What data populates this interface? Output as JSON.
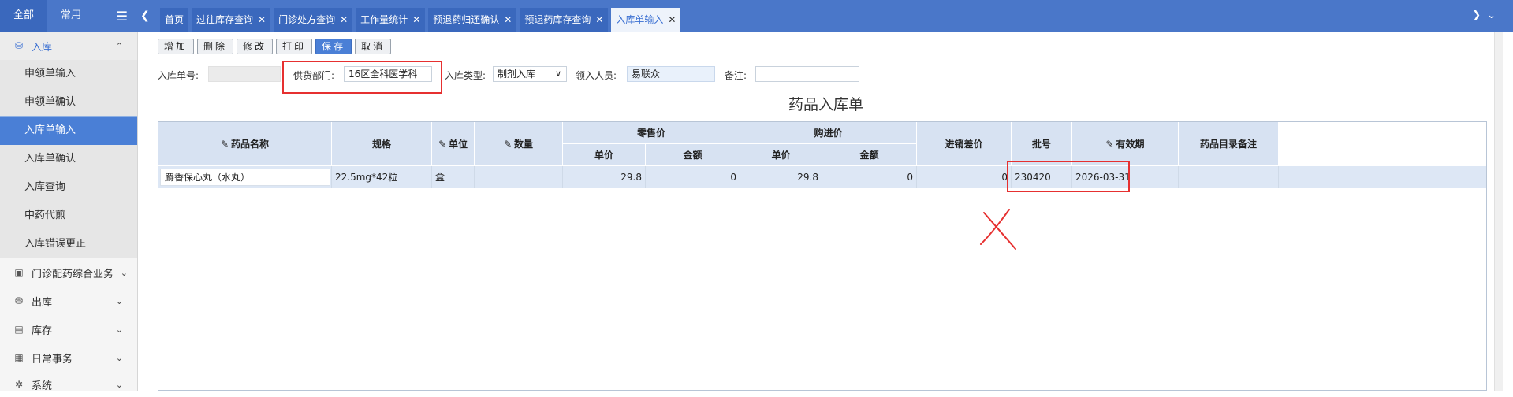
{
  "sidebar": {
    "tabs": [
      "全部",
      "常用"
    ],
    "groups": {
      "inbound": "入库",
      "outpatient": "门诊配药综合业务",
      "outbound": "出库",
      "stock": "库存",
      "daily": "日常事务",
      "system": "系统"
    },
    "inbound_items": [
      "申领单输入",
      "申领单确认",
      "入库单输入",
      "入库单确认",
      "入库查询",
      "中药代煎",
      "入库错误更正"
    ]
  },
  "tabs": [
    "首页",
    "过往库存查询",
    "门诊处方查询",
    "工作量统计",
    "预退药归还确认",
    "预退药库存查询",
    "入库单输入"
  ],
  "toolbar": {
    "add": "增加",
    "delete": "删除",
    "edit": "修改",
    "print": "打印",
    "save": "保存",
    "cancel": "取消"
  },
  "form": {
    "order_no_label": "入库单号:",
    "order_no_value": "",
    "supplier_label": "供货部门:",
    "supplier_value": "16区全科医学科",
    "type_label": "入库类型:",
    "type_value": "制剂入库",
    "receiver_label": "领入人员:",
    "receiver_value": "易联众",
    "remark_label": "备注:",
    "remark_value": ""
  },
  "page_title": "药品入库单",
  "grid": {
    "headers": {
      "name": "药品名称",
      "spec": "规格",
      "unit": "单位",
      "qty": "数量",
      "retail": "零售价",
      "purchase": "购进价",
      "price": "单价",
      "amount": "金额",
      "diff": "进销差价",
      "batch": "批号",
      "expiry": "有效期",
      "remark": "药品目录备注"
    },
    "row": {
      "name": "麝香保心丸（水丸）",
      "spec": "22.5mg*42粒",
      "unit": "盒",
      "qty": "",
      "retail_price": "29.8",
      "retail_amount": "0",
      "purchase_price": "29.8",
      "purchase_amount": "0",
      "diff": "0",
      "batch": "230420",
      "expiry": "2026-03-31",
      "remark": ""
    }
  },
  "colors": {
    "accent": "#4a77c9",
    "active_item": "#4a7fd6",
    "header_bg": "#d7e2f2",
    "annotation_red": "#e63030"
  }
}
